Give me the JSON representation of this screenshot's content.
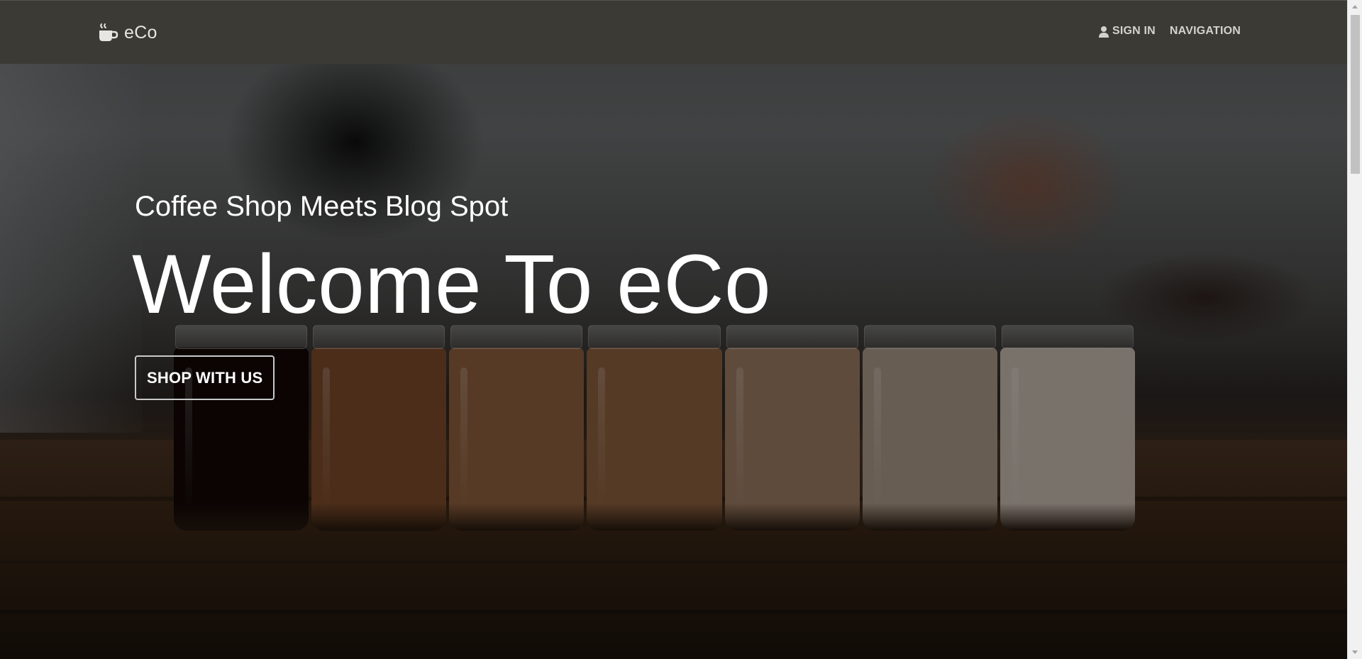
{
  "navbar": {
    "brand_name": "eCo",
    "brand_icon": "coffee-cup-icon",
    "links": [
      {
        "label": "SIGN IN",
        "icon": "user-icon"
      },
      {
        "label": "NAVIGATION"
      }
    ]
  },
  "hero": {
    "subheading": "Coffee Shop Meets Blog Spot",
    "heading": "Welcome To eCo",
    "cta_label": "SHOP WITH US"
  },
  "colors": {
    "navbar_bg": "#3b3a35",
    "text": "#ffffff",
    "jar_liquids": [
      "#120806",
      "#7a4a2a",
      "#8c5e3d",
      "#8a5e3e",
      "#9a7a62",
      "#a99786",
      "#c4b8ad"
    ]
  }
}
